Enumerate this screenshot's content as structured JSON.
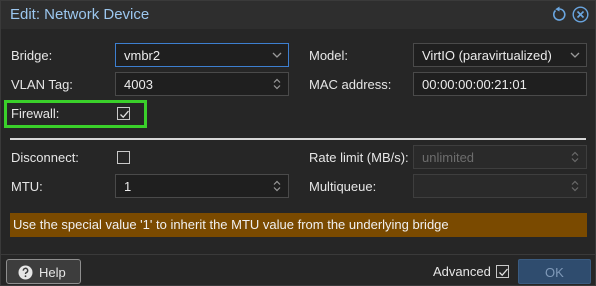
{
  "dialog": {
    "title": "Edit: Network Device",
    "reset_icon": "reset-icon",
    "close_icon": "close-icon"
  },
  "fields": {
    "bridge": {
      "label": "Bridge:",
      "value": "vmbr2"
    },
    "vlan_tag": {
      "label": "VLAN Tag:",
      "value": "4003"
    },
    "firewall": {
      "label": "Firewall:",
      "checked": true
    },
    "model": {
      "label": "Model:",
      "value": "VirtIO (paravirtualized)"
    },
    "mac_address": {
      "label": "MAC address:",
      "value": "00:00:00:00:21:01"
    },
    "disconnect": {
      "label": "Disconnect:",
      "checked": false
    },
    "mtu": {
      "label": "MTU:",
      "value": "1"
    },
    "rate_limit": {
      "label": "Rate limit (MB/s):",
      "placeholder": "unlimited"
    },
    "multiqueue": {
      "label": "Multiqueue:",
      "value": ""
    }
  },
  "info_message": "Use the special value '1' to inherit the MTU value from the underlying bridge",
  "footer": {
    "help_label": "Help",
    "advanced_label": "Advanced",
    "advanced_checked": true,
    "ok_label": "OK"
  },
  "colors": {
    "title": "#9cc7ef",
    "highlight": "#3ad02a",
    "info_bg": "#7a4a00",
    "focus_border": "#3d7fd0"
  }
}
